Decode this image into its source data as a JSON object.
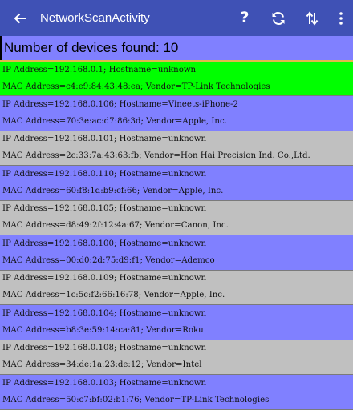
{
  "toolbar": {
    "title": "NetworkScanActivity",
    "background": "#3f51b5",
    "icons": [
      "arrow-back-icon",
      "help-icon",
      "refresh-icon",
      "sort-icon",
      "overflow-menu-icon"
    ]
  },
  "summary": {
    "text": "Number of devices found: 10"
  },
  "colors": {
    "highlight": "#00ff00",
    "row_blue": "#8080ff",
    "row_gray": "#c0c0c0",
    "accent_line": "#e1b54c"
  },
  "devices": [
    {
      "ip_line": "IP Address=192.168.0.1; Hostname=unknown",
      "mac_line": "MAC Address=c4:e9:84:43:48:ea; Vendor=TP-Link Technologies",
      "color": "#00ff00"
    },
    {
      "ip_line": "IP Address=192.168.0.106; Hostname=Vineets-iPhone-2",
      "mac_line": "MAC Address=70:3e:ac:d7:86:3d; Vendor=Apple, Inc.",
      "color": "#8080ff"
    },
    {
      "ip_line": "IP Address=192.168.0.101; Hostname=unknown",
      "mac_line": "MAC Address=2c:33:7a:43:63:fb; Vendor=Hon Hai Precision Ind. Co.,Ltd.",
      "color": "#c0c0c0"
    },
    {
      "ip_line": "IP Address=192.168.0.110; Hostname=unknown",
      "mac_line": "MAC Address=60:f8:1d:b9:cf:66; Vendor=Apple, Inc.",
      "color": "#8080ff"
    },
    {
      "ip_line": "IP Address=192.168.0.105; Hostname=unknown",
      "mac_line": "MAC Address=d8:49:2f:12:4a:67; Vendor=Canon, Inc.",
      "color": "#c0c0c0"
    },
    {
      "ip_line": "IP Address=192.168.0.100; Hostname=unknown",
      "mac_line": "MAC Address=00:d0:2d:75:d9:f1; Vendor=Ademco",
      "color": "#8080ff"
    },
    {
      "ip_line": "IP Address=192.168.0.109; Hostname=unknown",
      "mac_line": "MAC Address=1c:5c:f2:66:16:78; Vendor=Apple, Inc.",
      "color": "#c0c0c0"
    },
    {
      "ip_line": "IP Address=192.168.0.104; Hostname=unknown",
      "mac_line": "MAC Address=b8:3e:59:14:ca:81; Vendor=Roku",
      "color": "#8080ff"
    },
    {
      "ip_line": "IP Address=192.168.0.108; Hostname=unknown",
      "mac_line": "MAC Address=34:de:1a:23:de:12; Vendor=Intel",
      "color": "#c0c0c0"
    },
    {
      "ip_line": "IP Address=192.168.0.103; Hostname=unknown",
      "mac_line": "MAC Address=50:c7:bf:02:b1:76; Vendor=TP-Link Technologies",
      "color": "#8080ff"
    }
  ]
}
